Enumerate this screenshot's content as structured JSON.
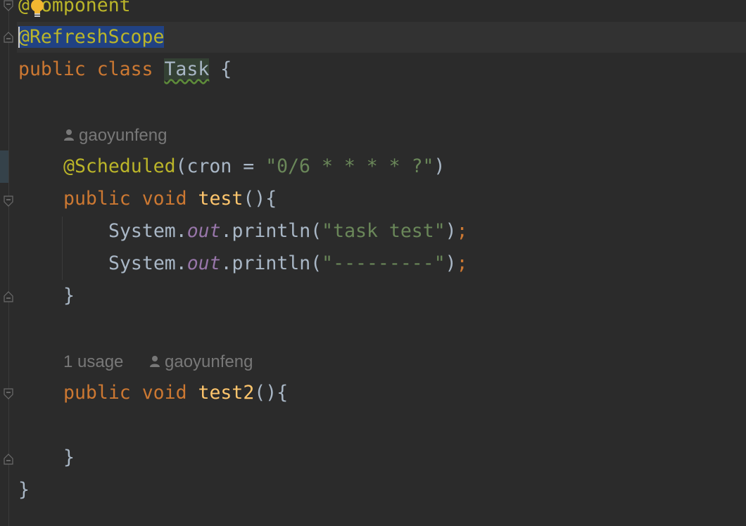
{
  "editor": {
    "lines": {
      "component": {
        "at": "@",
        "rest": "omponent"
      },
      "refresh_scope": "@RefreshScope",
      "class_decl": {
        "kw1": "public",
        "kw2": "class",
        "name": "Task",
        "brace": "{"
      },
      "scheduled": {
        "ann": "@Scheduled",
        "open": "(cron = ",
        "value": "\"0/6 * * * * ?\"",
        "close": ")"
      },
      "test_decl": {
        "kw1": "public",
        "kw2": "void",
        "name": "test",
        "rest": "(){"
      },
      "println1": {
        "obj": "System.",
        "field": "out",
        "call": ".println(",
        "arg": "\"task test\"",
        "close": ")",
        "semi": ";"
      },
      "println2": {
        "obj": "System.",
        "field": "out",
        "call": ".println(",
        "arg": "\"---------\"",
        "close": ")",
        "semi": ";"
      },
      "close_test": "}",
      "test2_decl": {
        "kw1": "public",
        "kw2": "void",
        "name": "test2",
        "rest": "(){"
      },
      "close_test2": "}",
      "close_class": "}"
    },
    "inlays": {
      "author1": "gaoyunfeng",
      "usages2": "1 usage",
      "author2": "gaoyunfeng"
    },
    "icons": {
      "bulb": "lightbulb-icon",
      "user": "user-icon",
      "fold": "fold-marker-icon"
    },
    "colors": {
      "background": "#2b2b2b",
      "annotation": "#bbb529",
      "keyword": "#cc7832",
      "function": "#ffc66d",
      "string": "#6a8759",
      "field": "#9876aa",
      "text": "#a9b7c6",
      "selection": "#214283",
      "inlay": "#787878"
    }
  }
}
